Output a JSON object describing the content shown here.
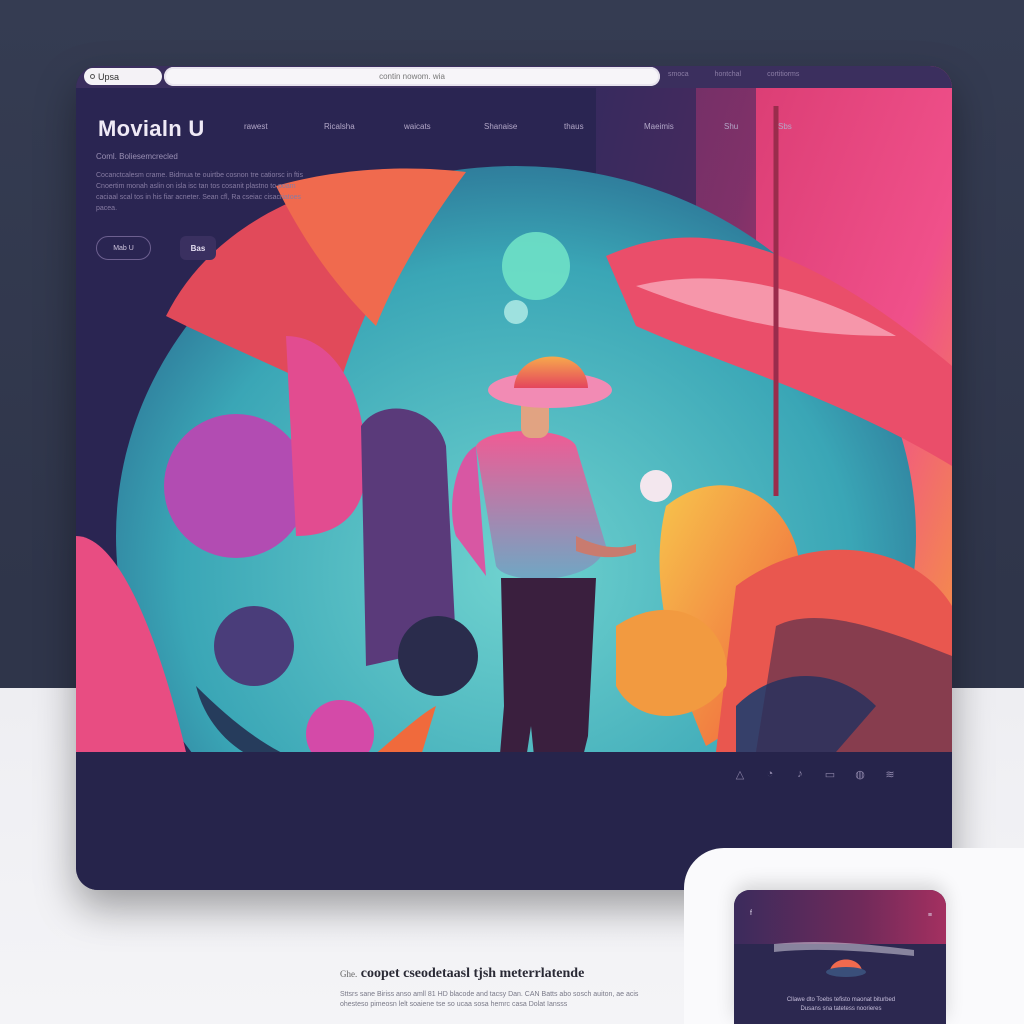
{
  "browser": {
    "tab_label": "Upsa",
    "url": "contin nowom. wia",
    "chrome_tabs": [
      "smoca",
      "hontchal",
      "cortitiorms"
    ]
  },
  "site": {
    "logo": "Movialn  U",
    "nav": [
      "rawest",
      "Ricalsha",
      "waicats",
      "Shanaise",
      "thaus",
      "Maeimis",
      "Shu",
      "Sbs"
    ],
    "tagline": "Coml. Boliesemcrecled",
    "description": "Cocanctcalesm crame. Bidmua te ouirtbe cosnon tre catiorsc in ftis Cnoertim monah aslin on isla isc tan tos cosanit plastno to poam caciaal scal tos in his fiar acneter. Sean cfl, Ra cseiac cisacriatoes pacea.",
    "more_button": "Mab U",
    "ghost_button": "Bas"
  },
  "footer_icons": [
    "warning-icon",
    "circle-icon",
    "bell-icon",
    "speaker-icon",
    "bookmark-icon",
    "wave-icon"
  ],
  "footer_glyphs": [
    "△",
    "◔",
    "♪",
    "▭",
    "◍",
    "≋"
  ],
  "bottom": {
    "headline": "coopet cseodetaasl tjsh meterrlatende",
    "subline": "Sttsrs sane Biriss anso amll 81 HD blacode and tacsy Dan. CAN Batts abo sosch auiton, ae acis ohesteso pimeosn lelt soaiene tse so ucaa sosa hemrc casa Dolat Iansss",
    "prefix": "Ghe."
  },
  "phone": {
    "title": "f",
    "menu": "≡",
    "caption": "Cllawe dto Toebs tefisto maonat biturbed Dusans sna tatetess noorieres"
  },
  "colors": {
    "frame": "#2a2552",
    "accent_pink": "#e64f8e",
    "accent_orange": "#f28b3b",
    "accent_teal": "#5ec6c9",
    "purple": "#8a4ba6"
  }
}
